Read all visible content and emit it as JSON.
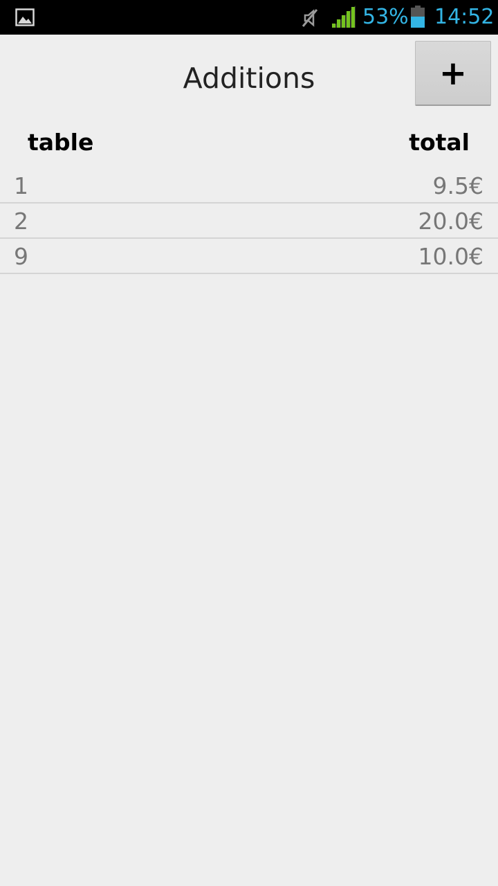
{
  "status_bar": {
    "icons": [
      "gallery-icon",
      "mute-icon",
      "signal-icon",
      "battery-icon"
    ],
    "battery_percent": "53%",
    "time": "14:52",
    "accent_color": "#33b5e5"
  },
  "header": {
    "title": "Additions",
    "add_button_label": "+"
  },
  "table": {
    "columns": [
      "table",
      "total"
    ],
    "rows": [
      {
        "table": "1",
        "total": "9.5€"
      },
      {
        "table": "2",
        "total": "20.0€"
      },
      {
        "table": "9",
        "total": "10.0€"
      }
    ]
  }
}
